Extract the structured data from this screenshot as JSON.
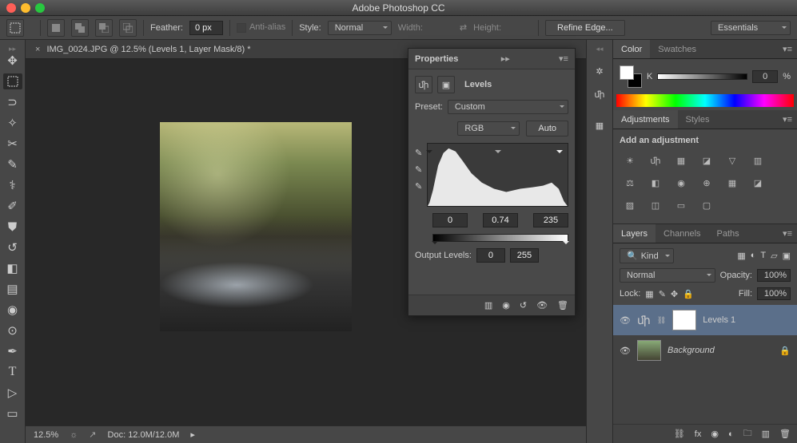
{
  "app": {
    "title": "Adobe Photoshop CC"
  },
  "options": {
    "feather_label": "Feather:",
    "feather_value": "0 px",
    "antialias_label": "Anti-alias",
    "style_label": "Style:",
    "style_value": "Normal",
    "width_label": "Width:",
    "height_label": "Height:",
    "refine_edge": "Refine Edge...",
    "workspace": "Essentials"
  },
  "document": {
    "tab_title": "IMG_0024.JPG @ 12.5% (Levels 1, Layer Mask/8) *",
    "zoom": "12.5%",
    "doc_size": "Doc: 12.0M/12.0M"
  },
  "properties": {
    "title": "Properties",
    "type_label": "Levels",
    "preset_label": "Preset:",
    "preset_value": "Custom",
    "channel_value": "RGB",
    "auto": "Auto",
    "input_black": "0",
    "input_gamma": "0.74",
    "input_white": "235",
    "output_label": "Output Levels:",
    "output_black": "0",
    "output_white": "255"
  },
  "color_panel": {
    "tab_color": "Color",
    "tab_swatches": "Swatches",
    "k_label": "K",
    "k_value": "0",
    "k_pct": "%"
  },
  "adjustments": {
    "tab_adjustments": "Adjustments",
    "tab_styles": "Styles",
    "add_label": "Add an adjustment"
  },
  "layers": {
    "tab_layers": "Layers",
    "tab_channels": "Channels",
    "tab_paths": "Paths",
    "kind_filter": "Kind",
    "blend_mode": "Normal",
    "opacity_label": "Opacity:",
    "opacity_value": "100%",
    "lock_label": "Lock:",
    "fill_label": "Fill:",
    "fill_value": "100%",
    "items": [
      {
        "name": "Levels 1"
      },
      {
        "name": "Background"
      }
    ]
  }
}
